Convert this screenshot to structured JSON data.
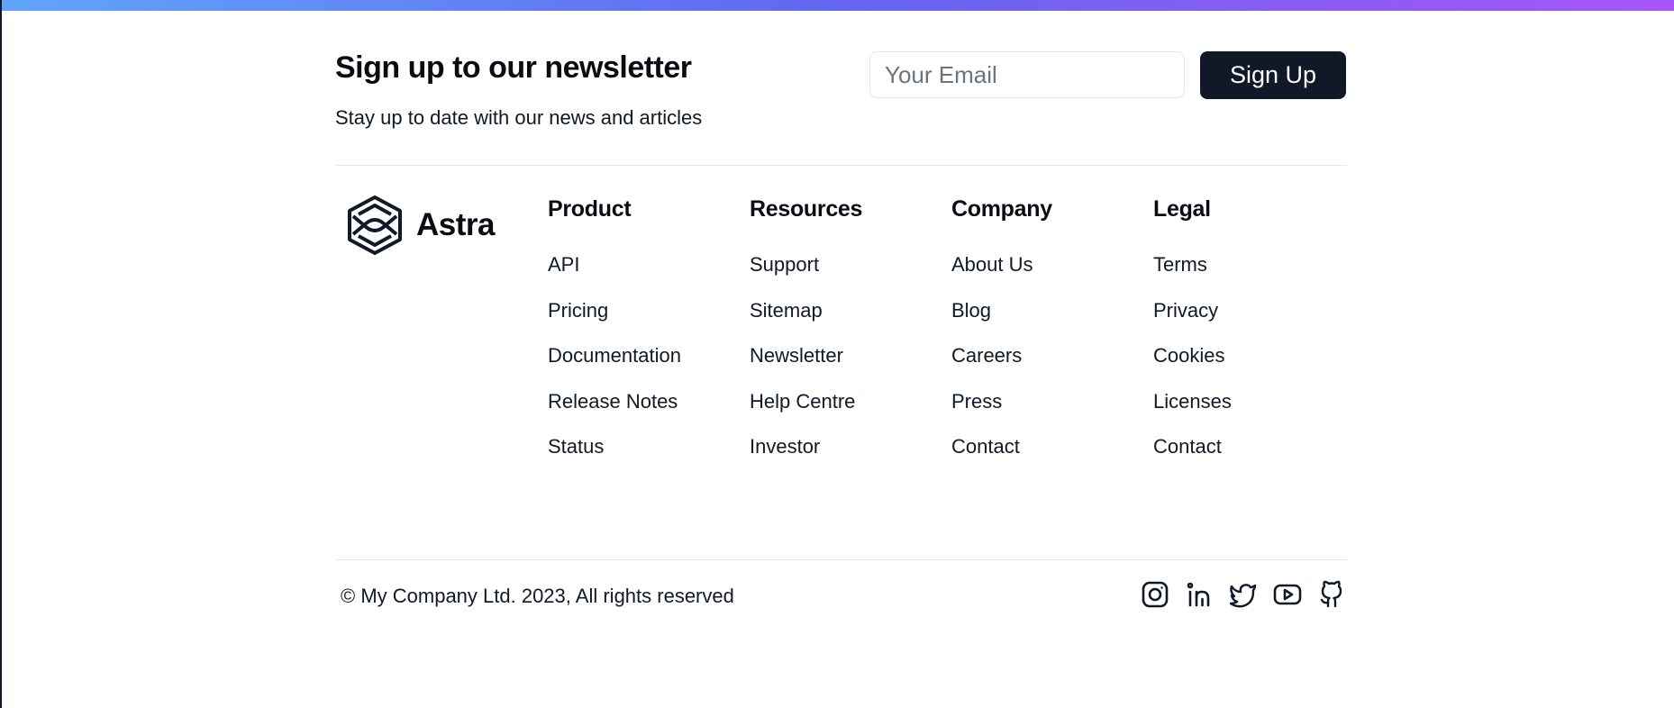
{
  "newsletter": {
    "title": "Sign up to our newsletter",
    "subtitle": "Stay up to date with our news and articles",
    "email_placeholder": "Your Email",
    "signup_label": "Sign Up"
  },
  "brand": {
    "name": "Astra",
    "logo_icon": "hexagon-logo-icon"
  },
  "columns": [
    {
      "heading": "Product",
      "links": [
        "API",
        "Pricing",
        "Documentation",
        "Release Notes",
        "Status"
      ]
    },
    {
      "heading": "Resources",
      "links": [
        "Support",
        "Sitemap",
        "Newsletter",
        "Help Centre",
        "Investor"
      ]
    },
    {
      "heading": "Company",
      "links": [
        "About Us",
        "Blog",
        "Careers",
        "Press",
        "Contact"
      ]
    },
    {
      "heading": "Legal",
      "links": [
        "Terms",
        "Privacy",
        "Cookies",
        "Licenses",
        "Contact"
      ]
    }
  ],
  "footer": {
    "copyright": "© My Company Ltd. 2023, All rights reserved",
    "socials": [
      "instagram-icon",
      "linkedin-icon",
      "twitter-icon",
      "youtube-icon",
      "github-icon"
    ]
  },
  "colors": {
    "primary": "#111827",
    "gradient_start": "#60a5fa",
    "gradient_mid": "#6366f1",
    "gradient_end": "#a855f7",
    "divider": "#e5e7eb"
  }
}
